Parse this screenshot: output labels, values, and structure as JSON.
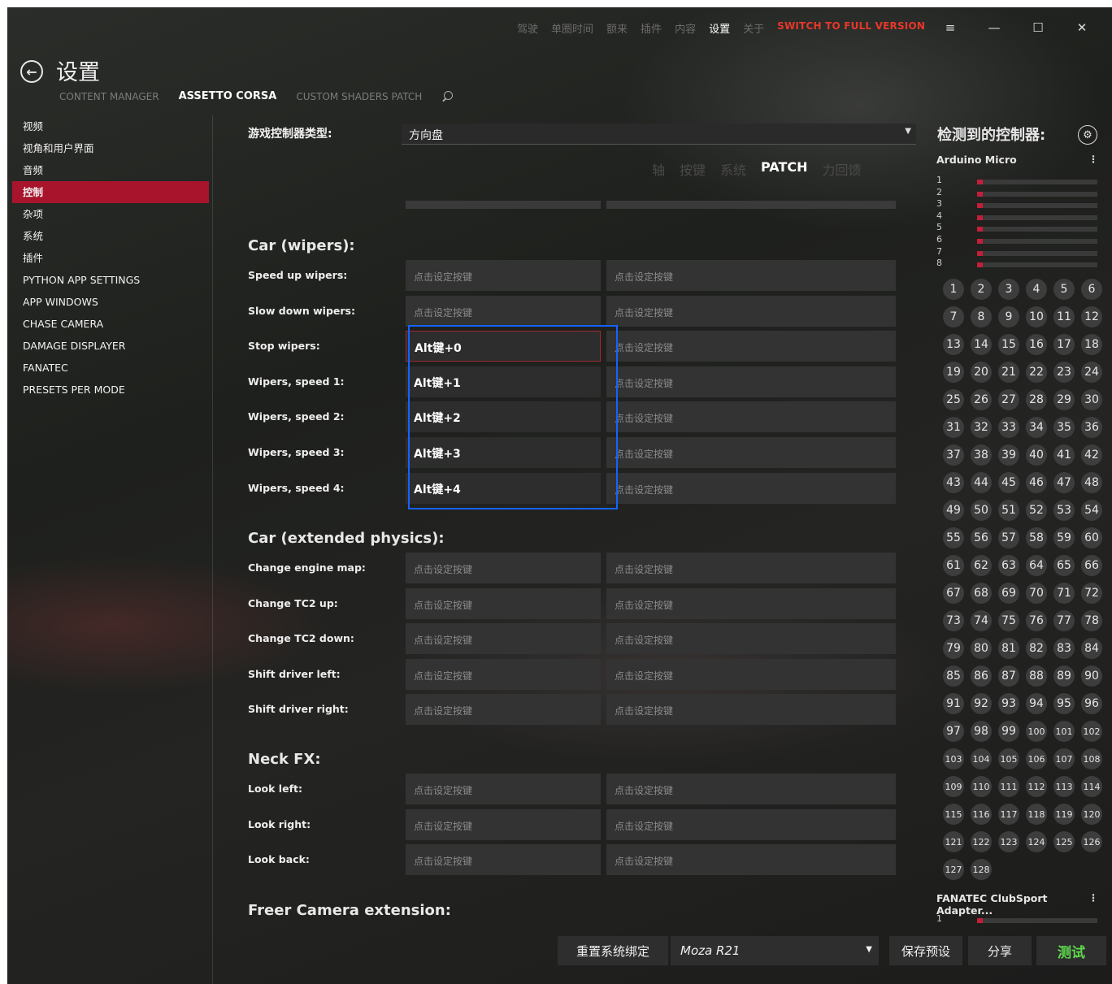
{
  "topmenu": {
    "items": [
      "驾驶",
      "单圈时间",
      "额来",
      "插件",
      "内容",
      "设置",
      "关于"
    ],
    "active_index": 5,
    "promo": "SWITCH TO FULL VERSION"
  },
  "window": {
    "title": "设置"
  },
  "tabs": {
    "content_manager": "CONTENT MANAGER",
    "assetto_corsa": "ASSETTO CORSA",
    "csp": "CUSTOM SHADERS PATCH"
  },
  "sidebar": {
    "items": [
      "视频",
      "视角和用户界面",
      "音频",
      "控制",
      "杂项",
      "系统",
      "插件",
      "PYTHON APP SETTINGS",
      "APP WINDOWS",
      "CHASE CAMERA",
      "DAMAGE DISPLAYER",
      "FANATEC",
      "PRESETS PER MODE"
    ],
    "active_index": 3
  },
  "controller": {
    "label": "游戏控制器类型:",
    "value": "方向盘"
  },
  "subtabs": {
    "items": [
      "轴",
      "按键",
      "系统",
      "PATCH",
      "力回馈"
    ],
    "active_index": 3
  },
  "placeholder": "点击设定按键",
  "sections": {
    "wipers": {
      "title": "Car (wipers):",
      "rows": [
        {
          "label": "Speed up wipers:",
          "b1": "点击设定按键",
          "b2": "点击设定按键"
        },
        {
          "label": "Slow down wipers:",
          "b1": "点击设定按键",
          "b2": "点击设定按键"
        },
        {
          "label": "Stop wipers:",
          "b1": "Alt键+0",
          "b2": "点击设定按键"
        },
        {
          "label": "Wipers, speed 1:",
          "b1": "Alt键+1",
          "b2": "点击设定按键"
        },
        {
          "label": "Wipers, speed 2:",
          "b1": "Alt键+2",
          "b2": "点击设定按键"
        },
        {
          "label": "Wipers, speed 3:",
          "b1": "Alt键+3",
          "b2": "点击设定按键"
        },
        {
          "label": "Wipers, speed 4:",
          "b1": "Alt键+4",
          "b2": "点击设定按键"
        }
      ]
    },
    "physics": {
      "title": "Car (extended physics):",
      "rows": [
        {
          "label": "Change engine map:",
          "b1": "点击设定按键",
          "b2": "点击设定按键"
        },
        {
          "label": "Change TC2 up:",
          "b1": "点击设定按键",
          "b2": "点击设定按键"
        },
        {
          "label": "Change TC2 down:",
          "b1": "点击设定按键",
          "b2": "点击设定按键"
        },
        {
          "label": "Shift driver left:",
          "b1": "点击设定按键",
          "b2": "点击设定按键"
        },
        {
          "label": "Shift driver right:",
          "b1": "点击设定按键",
          "b2": "点击设定按键"
        }
      ]
    },
    "neck": {
      "title": "Neck FX:",
      "rows": [
        {
          "label": "Look left:",
          "b1": "点击设定按键",
          "b2": "点击设定按键"
        },
        {
          "label": "Look right:",
          "b1": "点击设定按键",
          "b2": "点击设定按键"
        },
        {
          "label": "Look back:",
          "b1": "点击设定按键",
          "b2": "点击设定按键"
        }
      ]
    },
    "freer": {
      "title": "Freer Camera extension:"
    }
  },
  "right_panel": {
    "title": "检测到的控制器:",
    "device1": "Arduino Micro",
    "axes": [
      "1",
      "2",
      "3",
      "4",
      "5",
      "6",
      "7",
      "8"
    ],
    "button_count": 128,
    "device2": "FANATEC ClubSport Adapter...",
    "device2_axes": [
      "1"
    ]
  },
  "bottom": {
    "reset": "重置系统绑定",
    "preset": "Moza R21",
    "save": "保存预设",
    "share": "分享",
    "test": "测试"
  },
  "colors": {
    "accent": "#a8142c",
    "highlight": "#1463ff",
    "promo": "#e8372a",
    "test": "#5ed84d"
  }
}
